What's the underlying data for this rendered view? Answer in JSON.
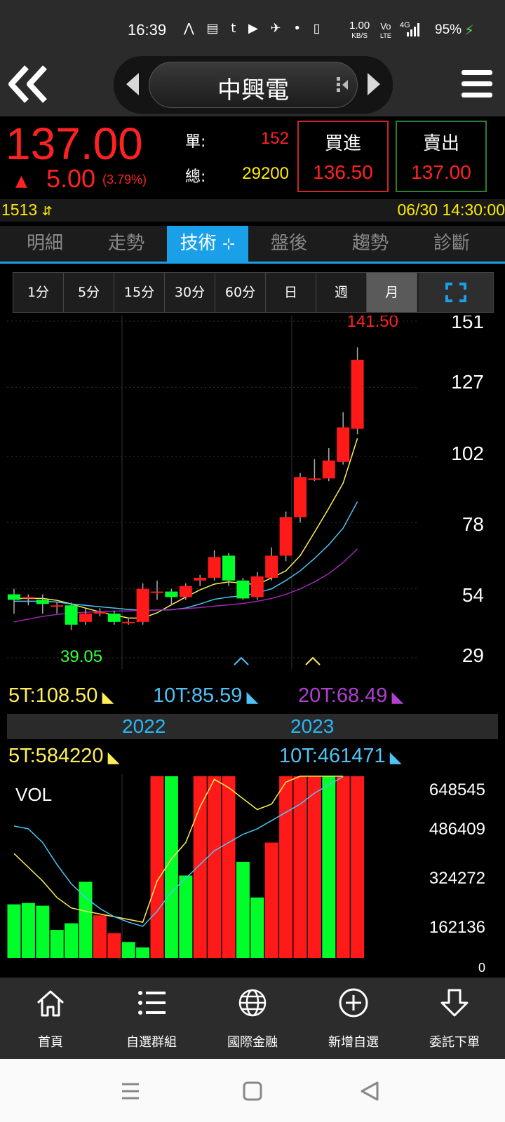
{
  "status_bar": {
    "time": "16:39",
    "icons_text": "⋀ ▤ t ▶ ✈ • ▯",
    "network_speed_value": "1.00",
    "network_speed_unit": "KB/S",
    "volte_top": "Vo",
    "volte_bottom": "LTE",
    "signal": "4G",
    "battery": "95%"
  },
  "header": {
    "stock_name": "中興電"
  },
  "quote": {
    "last_price": "137.00",
    "change_arrow": "▲",
    "change": "5.00",
    "change_pct": "(3.79%)",
    "single_label": "單:",
    "single_volume": "152",
    "total_label": "總:",
    "total_volume": "29200",
    "buy_label": "買進",
    "buy_price": "136.50",
    "sell_label": "賣出",
    "sell_price": "137.00"
  },
  "info": {
    "stock_code": "1513",
    "datetime": "06/30 14:30:00"
  },
  "tabs": [
    {
      "label": "明細"
    },
    {
      "label": "走勢"
    },
    {
      "label": "技術"
    },
    {
      "label": "盤後"
    },
    {
      "label": "趨勢"
    },
    {
      "label": "診斷"
    }
  ],
  "periods": [
    {
      "label": "1分"
    },
    {
      "label": "5分"
    },
    {
      "label": "15分"
    },
    {
      "label": "30分"
    },
    {
      "label": "60分"
    },
    {
      "label": "日"
    },
    {
      "label": "週"
    },
    {
      "label": "月"
    }
  ],
  "active_period": "月",
  "colors": {
    "up": "#ff1a1a",
    "down": "#00ff2a",
    "ma5": "#ffee58",
    "ma10": "#4fc3f7",
    "ma20": "#9c27b0",
    "accent": "#1aa0e8"
  },
  "ma_legend": {
    "ma5": "5T:108.50",
    "ma10": "10T:85.59",
    "ma20": "20T:68.49"
  },
  "vol_legend": {
    "ma5": "5T:584220",
    "ma10": "10T:461471"
  },
  "years": [
    "2022",
    "2023"
  ],
  "price_chart_labels": {
    "high_label": "141.50",
    "low_label": "39.05",
    "y_ticks": [
      "151",
      "127",
      "102",
      "78",
      "54",
      "29"
    ]
  },
  "volume_chart_labels": {
    "title": "VOL",
    "y_ticks": [
      "648545",
      "486409",
      "324272",
      "162136",
      "0"
    ]
  },
  "chart_data": [
    {
      "type": "candlestick",
      "title": "",
      "period": "月",
      "y_ticks": [
        151,
        127,
        102,
        78,
        54,
        29
      ],
      "ylim": [
        29,
        151
      ],
      "high": 141.5,
      "low": 39.05,
      "candles": [
        {
          "o": 52.0,
          "c": 50.0,
          "h": 54,
          "l": 45
        },
        {
          "o": 50.5,
          "c": 51.0,
          "h": 52,
          "l": 48
        },
        {
          "o": 50.0,
          "c": 48.5,
          "h": 52,
          "l": 45
        },
        {
          "o": 48.0,
          "c": 48.0,
          "h": 49,
          "l": 45
        },
        {
          "o": 48.0,
          "c": 41.0,
          "h": 49,
          "l": 39.05
        },
        {
          "o": 42.0,
          "c": 45.0,
          "h": 47,
          "l": 41
        },
        {
          "o": 45.0,
          "c": 45.5,
          "h": 47,
          "l": 44
        },
        {
          "o": 45.0,
          "c": 42.0,
          "h": 46,
          "l": 41
        },
        {
          "o": 42.0,
          "c": 42.0,
          "h": 43,
          "l": 41
        },
        {
          "o": 42.0,
          "c": 54.0,
          "h": 56,
          "l": 41
        },
        {
          "o": 53.0,
          "c": 53.0,
          "h": 57,
          "l": 50
        },
        {
          "o": 53.0,
          "c": 51.0,
          "h": 54,
          "l": 48
        },
        {
          "o": 51.0,
          "c": 55.0,
          "h": 56,
          "l": 50
        },
        {
          "o": 57.0,
          "c": 58.0,
          "h": 59,
          "l": 55
        },
        {
          "o": 58.0,
          "c": 65.5,
          "h": 68,
          "l": 57
        },
        {
          "o": 66.0,
          "c": 57.0,
          "h": 67,
          "l": 55
        },
        {
          "o": 57.0,
          "c": 50.5,
          "h": 58,
          "l": 50
        },
        {
          "o": 51.0,
          "c": 58.5,
          "h": 60,
          "l": 50
        },
        {
          "o": 58.0,
          "c": 66.0,
          "h": 69,
          "l": 57
        },
        {
          "o": 66.0,
          "c": 80.0,
          "h": 82,
          "l": 64
        },
        {
          "o": 80.0,
          "c": 94.5,
          "h": 96,
          "l": 78
        },
        {
          "o": 94.0,
          "c": 94.0,
          "h": 101,
          "l": 93
        },
        {
          "o": 94.0,
          "c": 100.5,
          "h": 105,
          "l": 93
        },
        {
          "o": 100.0,
          "c": 112.5,
          "h": 118,
          "l": 99
        },
        {
          "o": 112.0,
          "c": 137.0,
          "h": 141.5,
          "l": 110
        }
      ],
      "series": [
        {
          "name": "5T",
          "values": [
            50.5,
            50.5,
            50.5,
            49.8,
            48.5,
            47.0,
            45.6,
            44.5,
            43.4,
            43.4,
            45.3,
            48.2,
            51.0,
            53.6,
            55.7,
            56.5,
            56.0,
            55.5,
            58.0,
            60.5,
            66.0,
            74.5,
            83.2,
            92.3,
            108.5
          ]
        },
        {
          "name": "10T",
          "values": [
            49.5,
            49.5,
            49.5,
            49.2,
            48.5,
            48.0,
            47.5,
            47.0,
            46.5,
            46.2,
            46.3,
            46.4,
            47.0,
            48.5,
            50.2,
            51.0,
            51.5,
            52.5,
            54.0,
            57.0,
            60.5,
            65.0,
            70.0,
            76.0,
            85.59
          ]
        },
        {
          "name": "20T",
          "values": [
            42.0,
            43.0,
            44.0,
            44.7,
            45.2,
            45.5,
            45.7,
            45.9,
            46.0,
            46.1,
            46.3,
            46.5,
            46.8,
            47.2,
            47.7,
            48.2,
            48.7,
            49.5,
            50.5,
            52.0,
            54.0,
            56.5,
            59.5,
            63.5,
            68.49
          ]
        }
      ]
    },
    {
      "type": "bar",
      "title": "VOL",
      "y_ticks": [
        648545,
        486409,
        324272,
        162136,
        0
      ],
      "ylim": [
        0,
        648545
      ],
      "values": [
        195000,
        200000,
        190000,
        102000,
        126000,
        277000,
        155000,
        90000,
        58000,
        38000,
        761000,
        750000,
        300000,
        876000,
        967000,
        790000,
        350000,
        220000,
        420000,
        1045000,
        740000,
        1210000,
        854000,
        1044000,
        1100000
      ],
      "directions": [
        "down",
        "down",
        "down",
        "down",
        "down",
        "down",
        "up",
        "up",
        "down",
        "down",
        "up",
        "down",
        "down",
        "up",
        "up",
        "up",
        "down",
        "down",
        "up",
        "up",
        "up",
        "up",
        "down",
        "up",
        "up"
      ],
      "series": [
        {
          "name": "5T",
          "values": [
            380000,
            330000,
            280000,
            220000,
            182000,
            170000,
            160000,
            150000,
            140000,
            130000,
            280000,
            360000,
            420000,
            550000,
            650000,
            620000,
            580000,
            540000,
            560000,
            640000,
            720000,
            860000,
            910000,
            960000,
            584220
          ]
        },
        {
          "name": "10T",
          "values": [
            480000,
            470000,
            420000,
            340000,
            270000,
            220000,
            180000,
            150000,
            130000,
            115000,
            170000,
            240000,
            290000,
            340000,
            390000,
            420000,
            450000,
            470000,
            500000,
            530000,
            560000,
            600000,
            630000,
            660000,
            461471
          ]
        }
      ]
    }
  ],
  "bottom_nav": [
    {
      "label": "首頁",
      "icon": "home-icon"
    },
    {
      "label": "自選群組",
      "icon": "list-icon"
    },
    {
      "label": "國際金融",
      "icon": "globe-icon"
    },
    {
      "label": "新增自選",
      "icon": "plus-circle-icon"
    },
    {
      "label": "委託下單",
      "icon": "arrow-down-icon"
    }
  ]
}
